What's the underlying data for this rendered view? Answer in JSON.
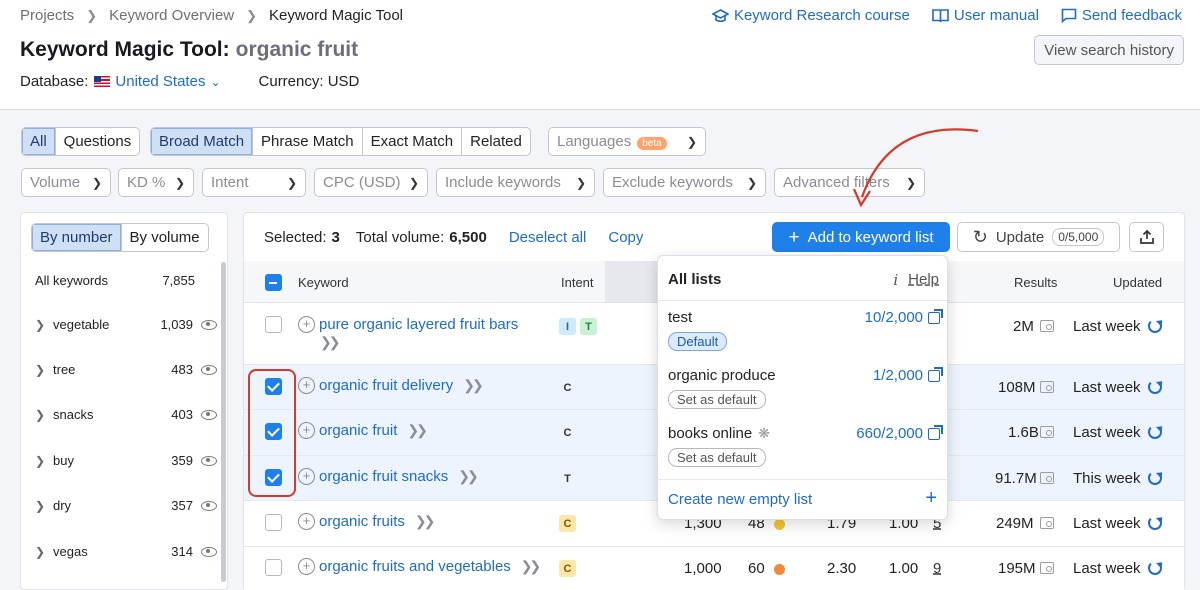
{
  "breadcrumb": {
    "items": [
      "Projects",
      "Keyword Overview",
      "Keyword Magic Tool"
    ]
  },
  "top_links": {
    "course": "Keyword Research course",
    "manual": "User manual",
    "feedback": "Send feedback"
  },
  "title": {
    "tool": "Keyword Magic Tool:",
    "query": "organic fruit"
  },
  "history_button": "View search history",
  "database": {
    "label": "Database:",
    "value": "United States",
    "currency": "Currency: USD"
  },
  "tabs_type": [
    "All",
    "Questions"
  ],
  "tabs_match": [
    "Broad Match",
    "Phrase Match",
    "Exact Match",
    "Related"
  ],
  "languages": {
    "label": "Languages",
    "badge": "beta"
  },
  "filters": [
    "Volume",
    "KD %",
    "Intent",
    "CPC (USD)",
    "Include keywords",
    "Exclude keywords",
    "Advanced filters"
  ],
  "sidebar": {
    "toggle": [
      "By number",
      "By volume"
    ],
    "all_label": "All keywords",
    "all_count": "7,855",
    "items": [
      {
        "name": "vegetable",
        "count": "1,039"
      },
      {
        "name": "tree",
        "count": "483"
      },
      {
        "name": "snacks",
        "count": "403"
      },
      {
        "name": "buy",
        "count": "359"
      },
      {
        "name": "dry",
        "count": "357"
      },
      {
        "name": "vegas",
        "count": "314"
      }
    ]
  },
  "selection": {
    "selected_label": "Selected:",
    "selected_count": "3",
    "volume_label": "Total volume:",
    "volume_value": "6,500",
    "deselect": "Deselect all",
    "copy": "Copy"
  },
  "toolbar": {
    "add": "Add to keyword list",
    "update": "Update",
    "update_count": "0/5,000"
  },
  "table": {
    "headers": {
      "keyword": "Keyword",
      "intent": "Intent",
      "results": "Results",
      "updated": "Updated"
    },
    "rows": [
      {
        "keyword": "pure organic layered fruit bars",
        "intent": [
          "I",
          "T"
        ],
        "volume": "",
        "kd": "",
        "cpc": "",
        "com": "",
        "sf": "",
        "results": "2M",
        "updated": "Last week",
        "selected": false
      },
      {
        "keyword": "organic fruit delivery",
        "intent": [
          "C"
        ],
        "volume": "",
        "kd": "",
        "cpc": "",
        "com": "",
        "sf": "",
        "results": "108M",
        "updated": "Last week",
        "selected": true
      },
      {
        "keyword": "organic fruit",
        "intent": [
          "C"
        ],
        "volume": "",
        "kd": "",
        "cpc": "",
        "com": "",
        "sf": "",
        "results": "1.6B",
        "updated": "Last week",
        "selected": true
      },
      {
        "keyword": "organic fruit snacks",
        "intent": [
          "T"
        ],
        "volume": "",
        "kd": "",
        "cpc": "",
        "com": "",
        "sf": "",
        "results": "91.7M",
        "updated": "This week",
        "selected": true
      },
      {
        "keyword": "organic fruits",
        "intent": [
          "C"
        ],
        "volume": "1,300",
        "kd": "48",
        "cpc": "1.79",
        "com": "1.00",
        "sf": "5",
        "results": "249M",
        "updated": "Last week",
        "selected": false
      },
      {
        "keyword": "organic fruits and vegetables",
        "intent": [
          "C"
        ],
        "volume": "1,000",
        "kd": "60",
        "cpc": "2.30",
        "com": "1.00",
        "sf": "9",
        "results": "195M",
        "updated": "Last week",
        "selected": false
      }
    ]
  },
  "dropdown": {
    "title": "All lists",
    "help": "Help",
    "lists": [
      {
        "name": "test",
        "count": "10/2,000",
        "tag": "Default"
      },
      {
        "name": "organic produce",
        "count": "1/2,000",
        "tag": "Set as default"
      },
      {
        "name": "books online",
        "count": "660/2,000",
        "tag": "Set as default"
      }
    ],
    "create": "Create new empty list"
  },
  "colors": {
    "accent": "#1e80e8",
    "link": "#1e6bc9",
    "annotation": "#d33a2c",
    "kd_yellow": "#f5c431",
    "kd_orange": "#f0883a"
  }
}
